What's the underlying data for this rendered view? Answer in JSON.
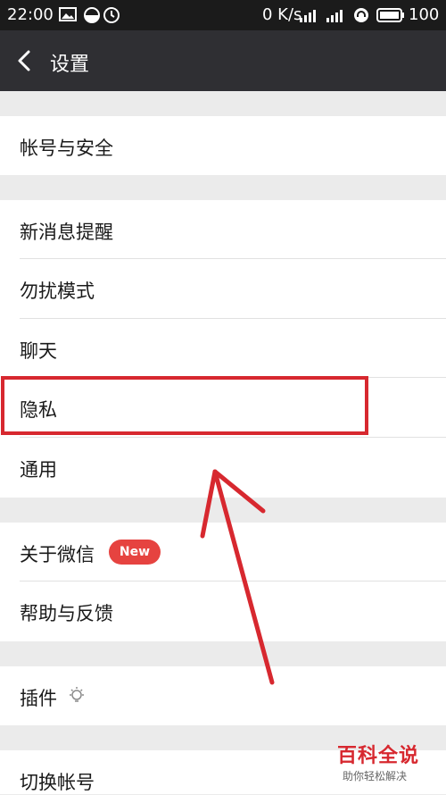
{
  "status_bar": {
    "time": "22:00",
    "net_speed": "0 K/s",
    "battery_percent": "100",
    "icons": [
      "image-icon",
      "data-saver-icon",
      "alarm-icon",
      "signal-4g-icon",
      "signal-icon",
      "headset-icon",
      "battery-icon"
    ]
  },
  "header": {
    "title": "设置",
    "back_icon": "chevron-left-icon"
  },
  "settings": {
    "account_security": "帐号与安全",
    "new_message_alert": "新消息提醒",
    "do_not_disturb": "勿扰模式",
    "chat": "聊天",
    "privacy": "隐私",
    "general": "通用",
    "about_wechat": "关于微信",
    "new_badge": "New",
    "help_feedback": "帮助与反馈",
    "plugins": "插件",
    "plugins_icon": "lightbulb-icon",
    "switch_account": "切换帐号"
  },
  "annotation": {
    "color": "#d7282f"
  },
  "watermark": {
    "main": "百科全说",
    "sub": "助你轻松解决"
  },
  "colors": {
    "header_bg": "#2f2f33",
    "status_bg": "#1b1b1b",
    "page_bg": "#ebebeb",
    "badge": "#e64340"
  }
}
